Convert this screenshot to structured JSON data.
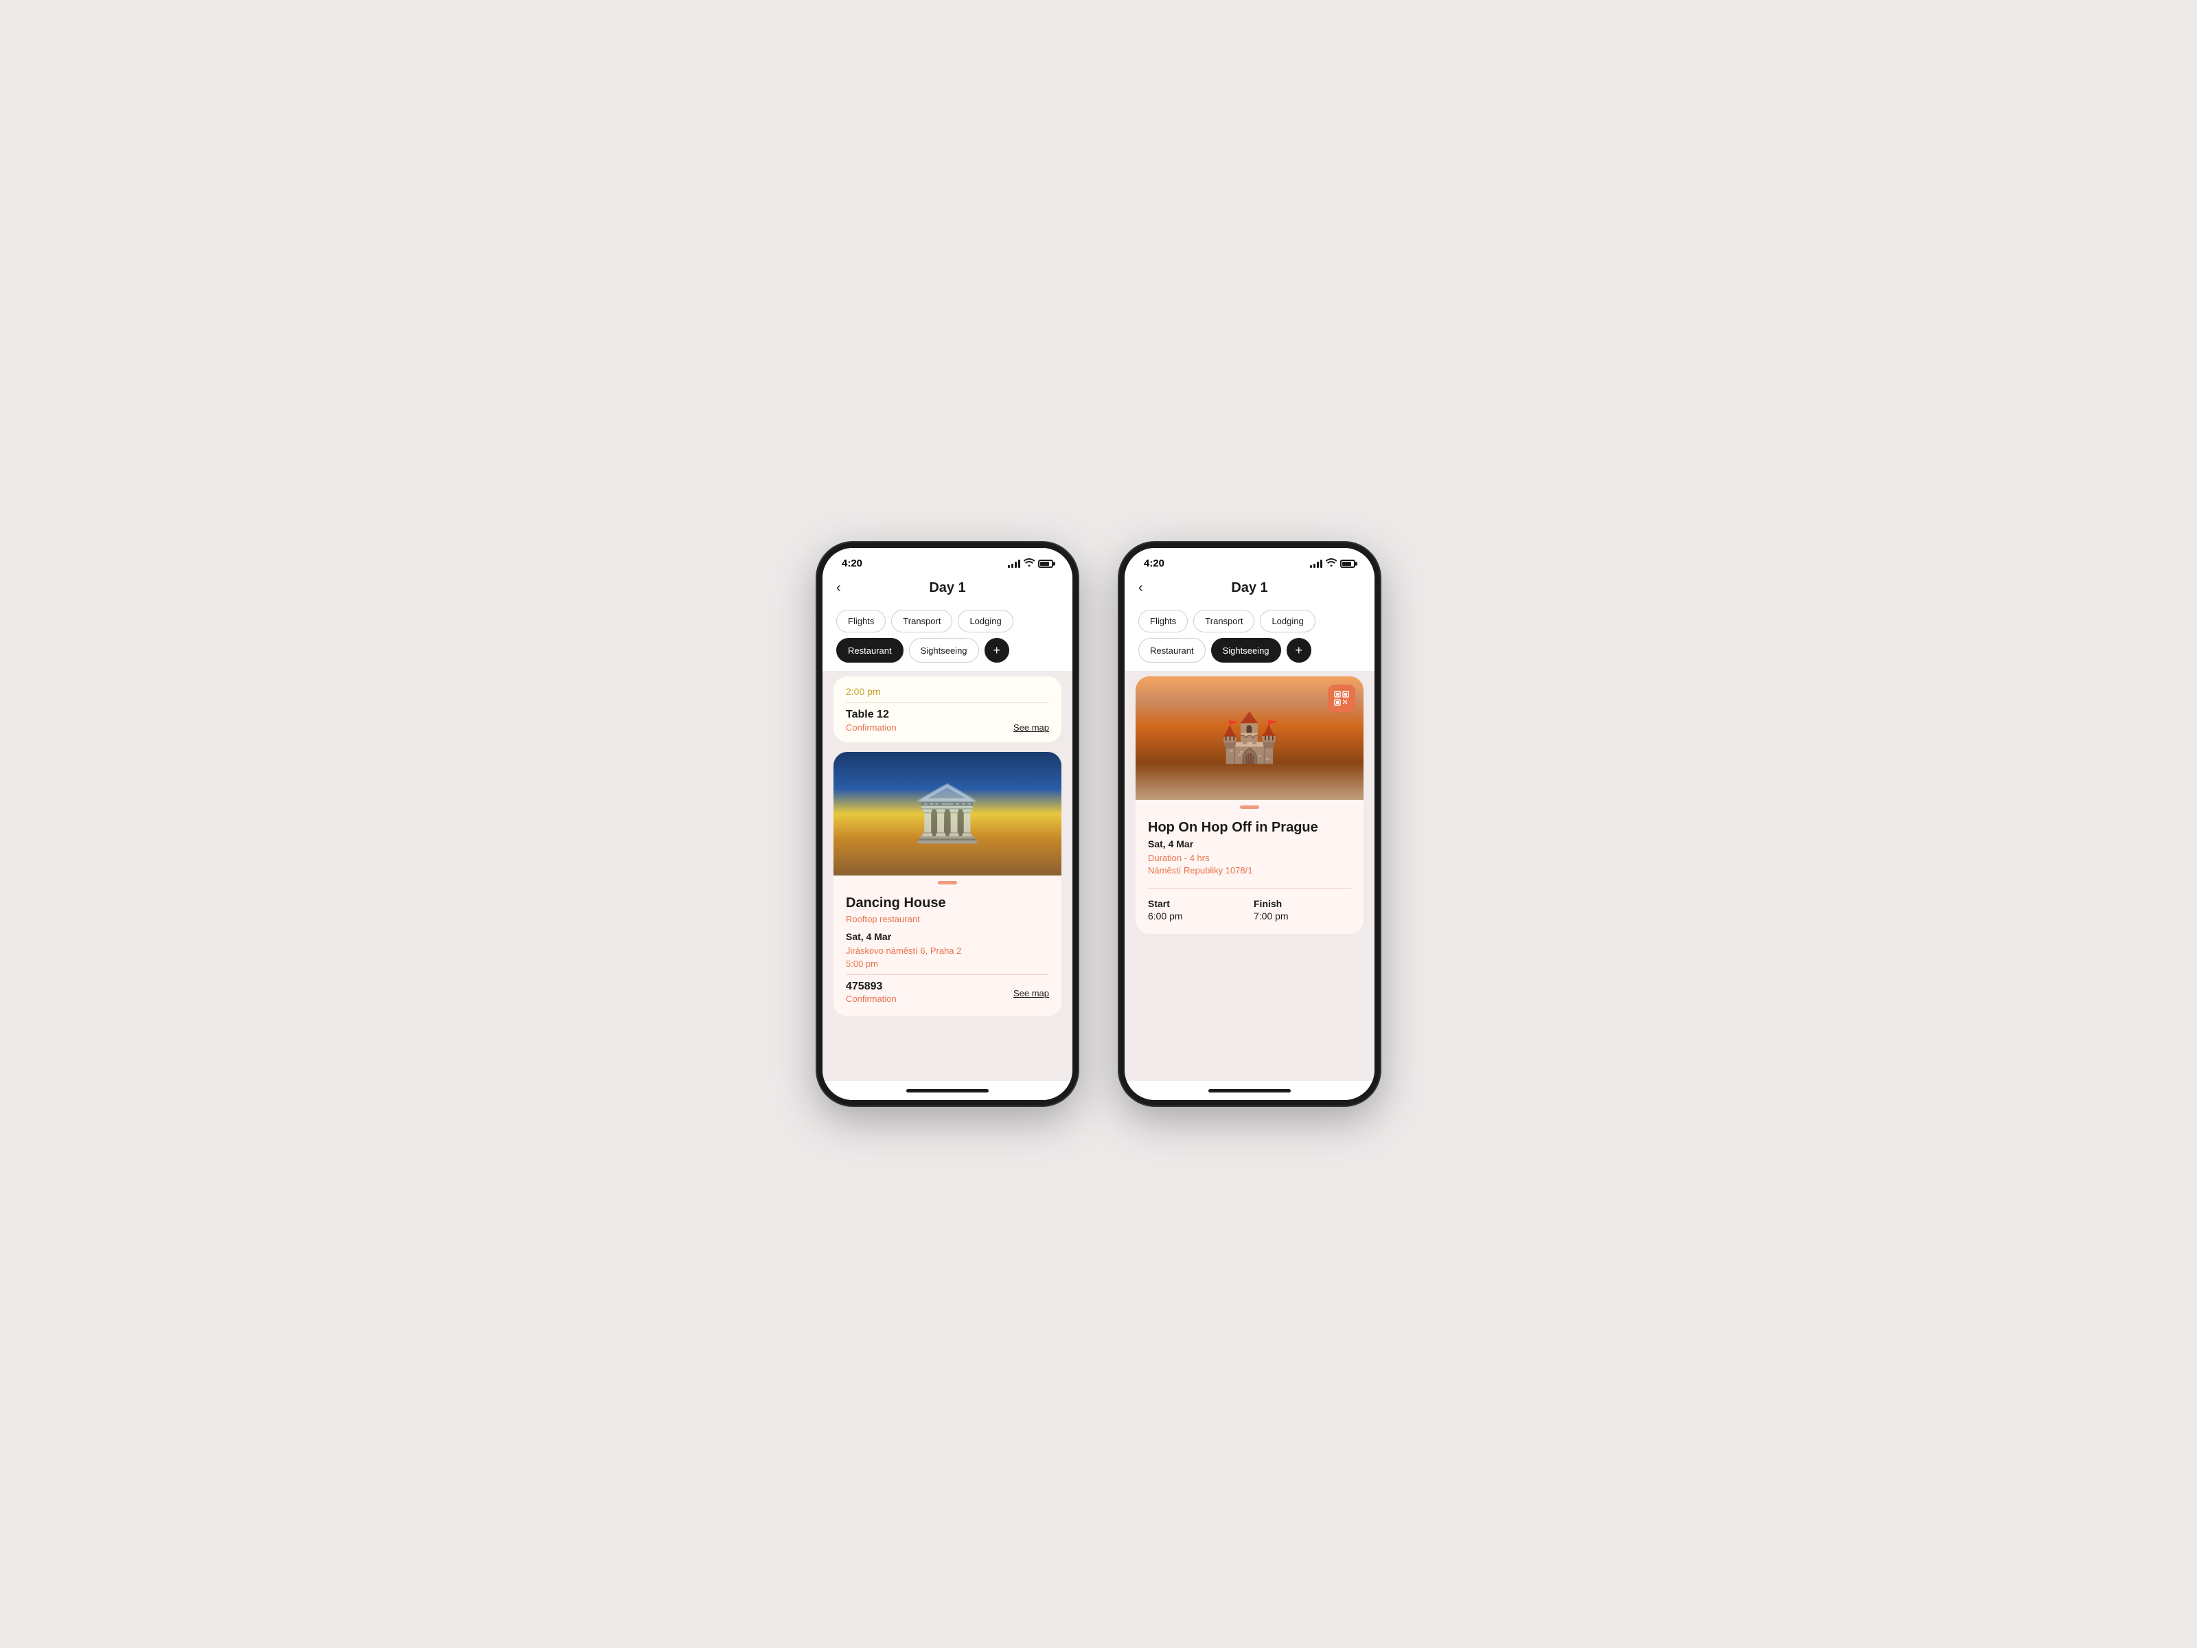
{
  "phones": [
    {
      "id": "phone-left",
      "status_time": "4:20",
      "header": {
        "back_label": "‹",
        "title": "Day 1"
      },
      "chips": [
        {
          "id": "flights",
          "label": "Flights",
          "active": false
        },
        {
          "id": "transport",
          "label": "Transport",
          "active": false
        },
        {
          "id": "lodging",
          "label": "Lodging",
          "active": false
        },
        {
          "id": "restaurant",
          "label": "Restaurant",
          "active": true
        },
        {
          "id": "sightseeing",
          "label": "Sightseeing",
          "active": false
        },
        {
          "id": "add",
          "label": "+",
          "active": true,
          "is_add": true
        }
      ],
      "cards": [
        {
          "type": "table",
          "theme": "light",
          "time": "2:00 pm",
          "table_name": "Table 12",
          "confirmation_label": "Confirmation",
          "see_map_label": "See map"
        },
        {
          "type": "venue",
          "theme": "pink",
          "image_type": "dancing-house",
          "venue_name": "Dancing House",
          "venue_subtitle": "Rooftop restaurant",
          "date": "Sat, 4 Mar",
          "address": "Jiráskovo náměstí 6, Praha 2",
          "time": "5:00 pm",
          "booking_id": "475893",
          "confirmation_label": "Confirmation",
          "see_map_label": "See map"
        }
      ]
    },
    {
      "id": "phone-right",
      "status_time": "4:20",
      "header": {
        "back_label": "‹",
        "title": "Day 1"
      },
      "chips": [
        {
          "id": "flights",
          "label": "Flights",
          "active": false
        },
        {
          "id": "transport",
          "label": "Transport",
          "active": false
        },
        {
          "id": "lodging",
          "label": "Lodging",
          "active": false
        },
        {
          "id": "restaurant",
          "label": "Restaurant",
          "active": false
        },
        {
          "id": "sightseeing",
          "label": "Sightseeing",
          "active": true
        },
        {
          "id": "add",
          "label": "+",
          "active": true,
          "is_add": true
        }
      ],
      "cards": [
        {
          "type": "sightseeing",
          "theme": "pink",
          "image_type": "prague",
          "qr_code": true,
          "venue_name": "Hop On Hop Off in Prague",
          "date": "Sat, 4 Mar",
          "duration": "Duration - 4 hrs",
          "address": "Náměstí Republiky 1078/1",
          "start_label": "Start",
          "start_time": "6:00 pm",
          "finish_label": "Finish",
          "finish_time": "7:00 pm"
        }
      ]
    }
  ]
}
